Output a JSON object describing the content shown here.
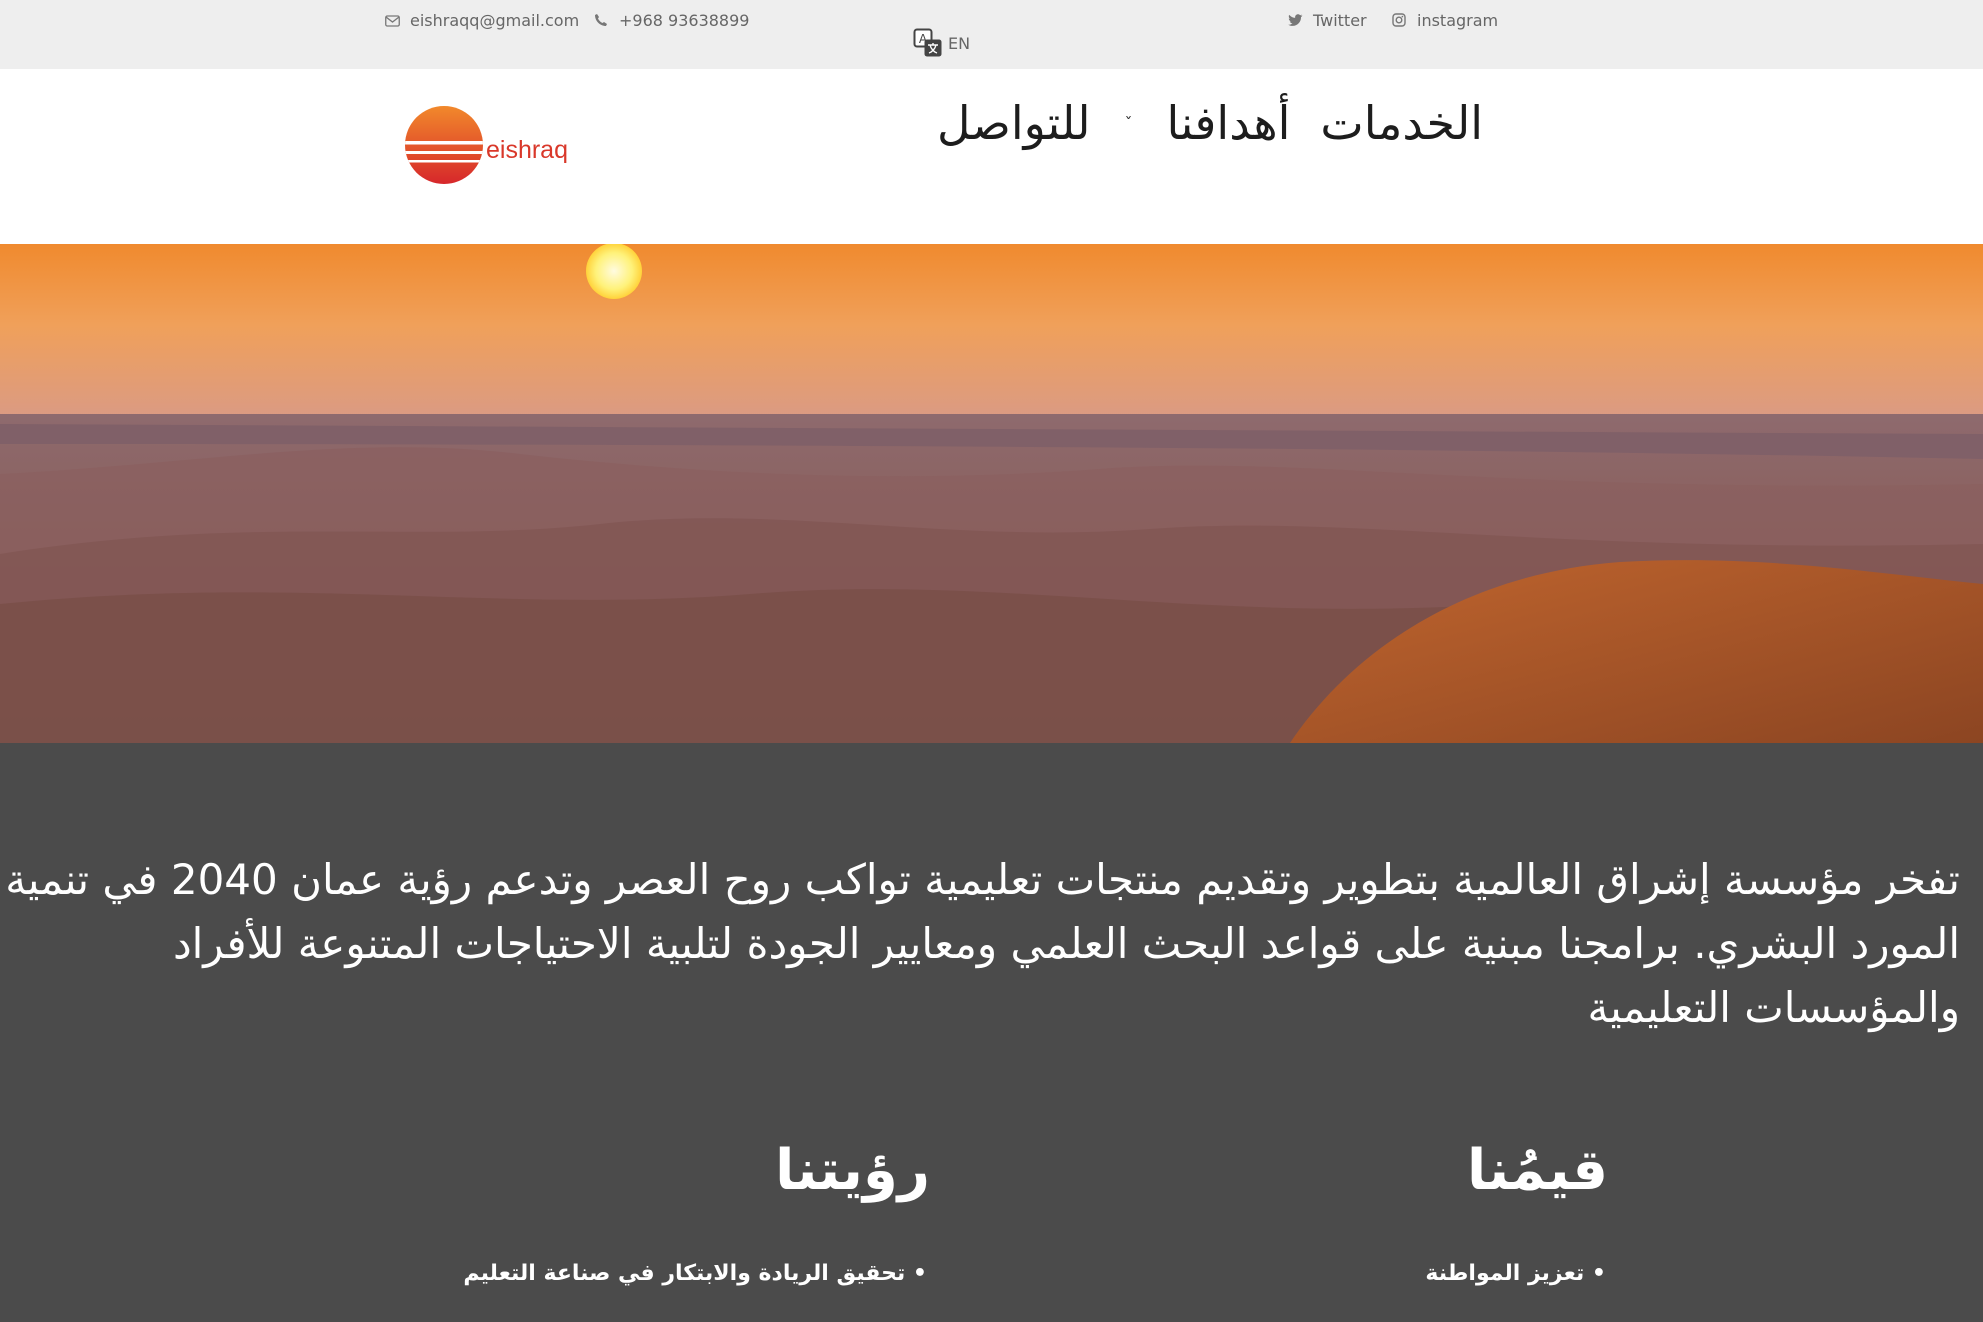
{
  "topbar": {
    "email": "eishraqq@gmail.com",
    "phone": "+968 93638899",
    "twitter": "Twitter",
    "instagram": "instagram",
    "language": "EN"
  },
  "header": {
    "logo_text": "eishraq",
    "nav": {
      "services": "الخدمات",
      "goals": "أهدافنا",
      "goals_caret": "ˇ",
      "contact": "للتواصل"
    }
  },
  "content": {
    "intro": "تفخر مؤسسة إشراق العالمية بتطوير وتقديم منتجات تعليمية تواكب روح العصر وتدعم رؤية عمان 2040 في تنمية المورد البشري. برامجنا مبنية على قواعد البحث العلمي ومعايير الجودة لتلبية الاحتياجات المتنوعة للأفراد والمؤسسات التعليمية",
    "values": {
      "title": "قيمُنا",
      "items": [
        "تعزيز المواطنة"
      ]
    },
    "vision": {
      "title": "رؤيتنا",
      "items": [
        "تحقيق الريادة والابتكار في صناعة التعليم"
      ]
    }
  },
  "colors": {
    "topbar_bg": "#eeeeee",
    "header_bg": "#ffffff",
    "content_bg": "#4b4b4b",
    "logo_red": "#d9382a",
    "logo_orange": "#f07a2a"
  },
  "icons": [
    "envelope-icon",
    "phone-icon",
    "twitter-icon",
    "instagram-icon",
    "translate-icon",
    "chevron-down-icon"
  ]
}
